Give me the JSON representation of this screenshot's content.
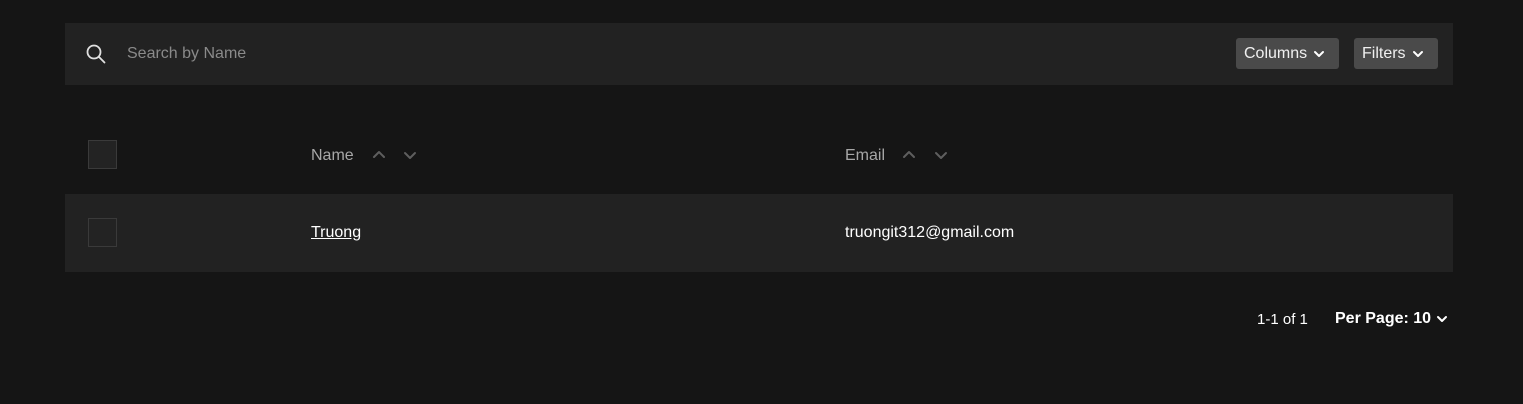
{
  "toolbar": {
    "search_placeholder": "Search by Name",
    "search_value": "",
    "columns_label": "Columns",
    "filters_label": "Filters"
  },
  "table": {
    "columns": [
      {
        "label": "Name"
      },
      {
        "label": "Email"
      }
    ],
    "rows": [
      {
        "name": "Truong",
        "email": "truongit312@gmail.com"
      }
    ]
  },
  "pagination": {
    "range": "1-1 of 1",
    "per_page_label": "Per Page: 10"
  },
  "icons": {
    "search": "search-icon",
    "dropdown": "chevron-down-icon",
    "sort_asc": "chevron-up-icon",
    "sort_desc": "chevron-down-icon"
  },
  "colors": {
    "background": "#151515",
    "panel": "#222222",
    "button": "#4a4a4a",
    "text": "#ffffff",
    "muted_text": "#a7a7a7"
  }
}
